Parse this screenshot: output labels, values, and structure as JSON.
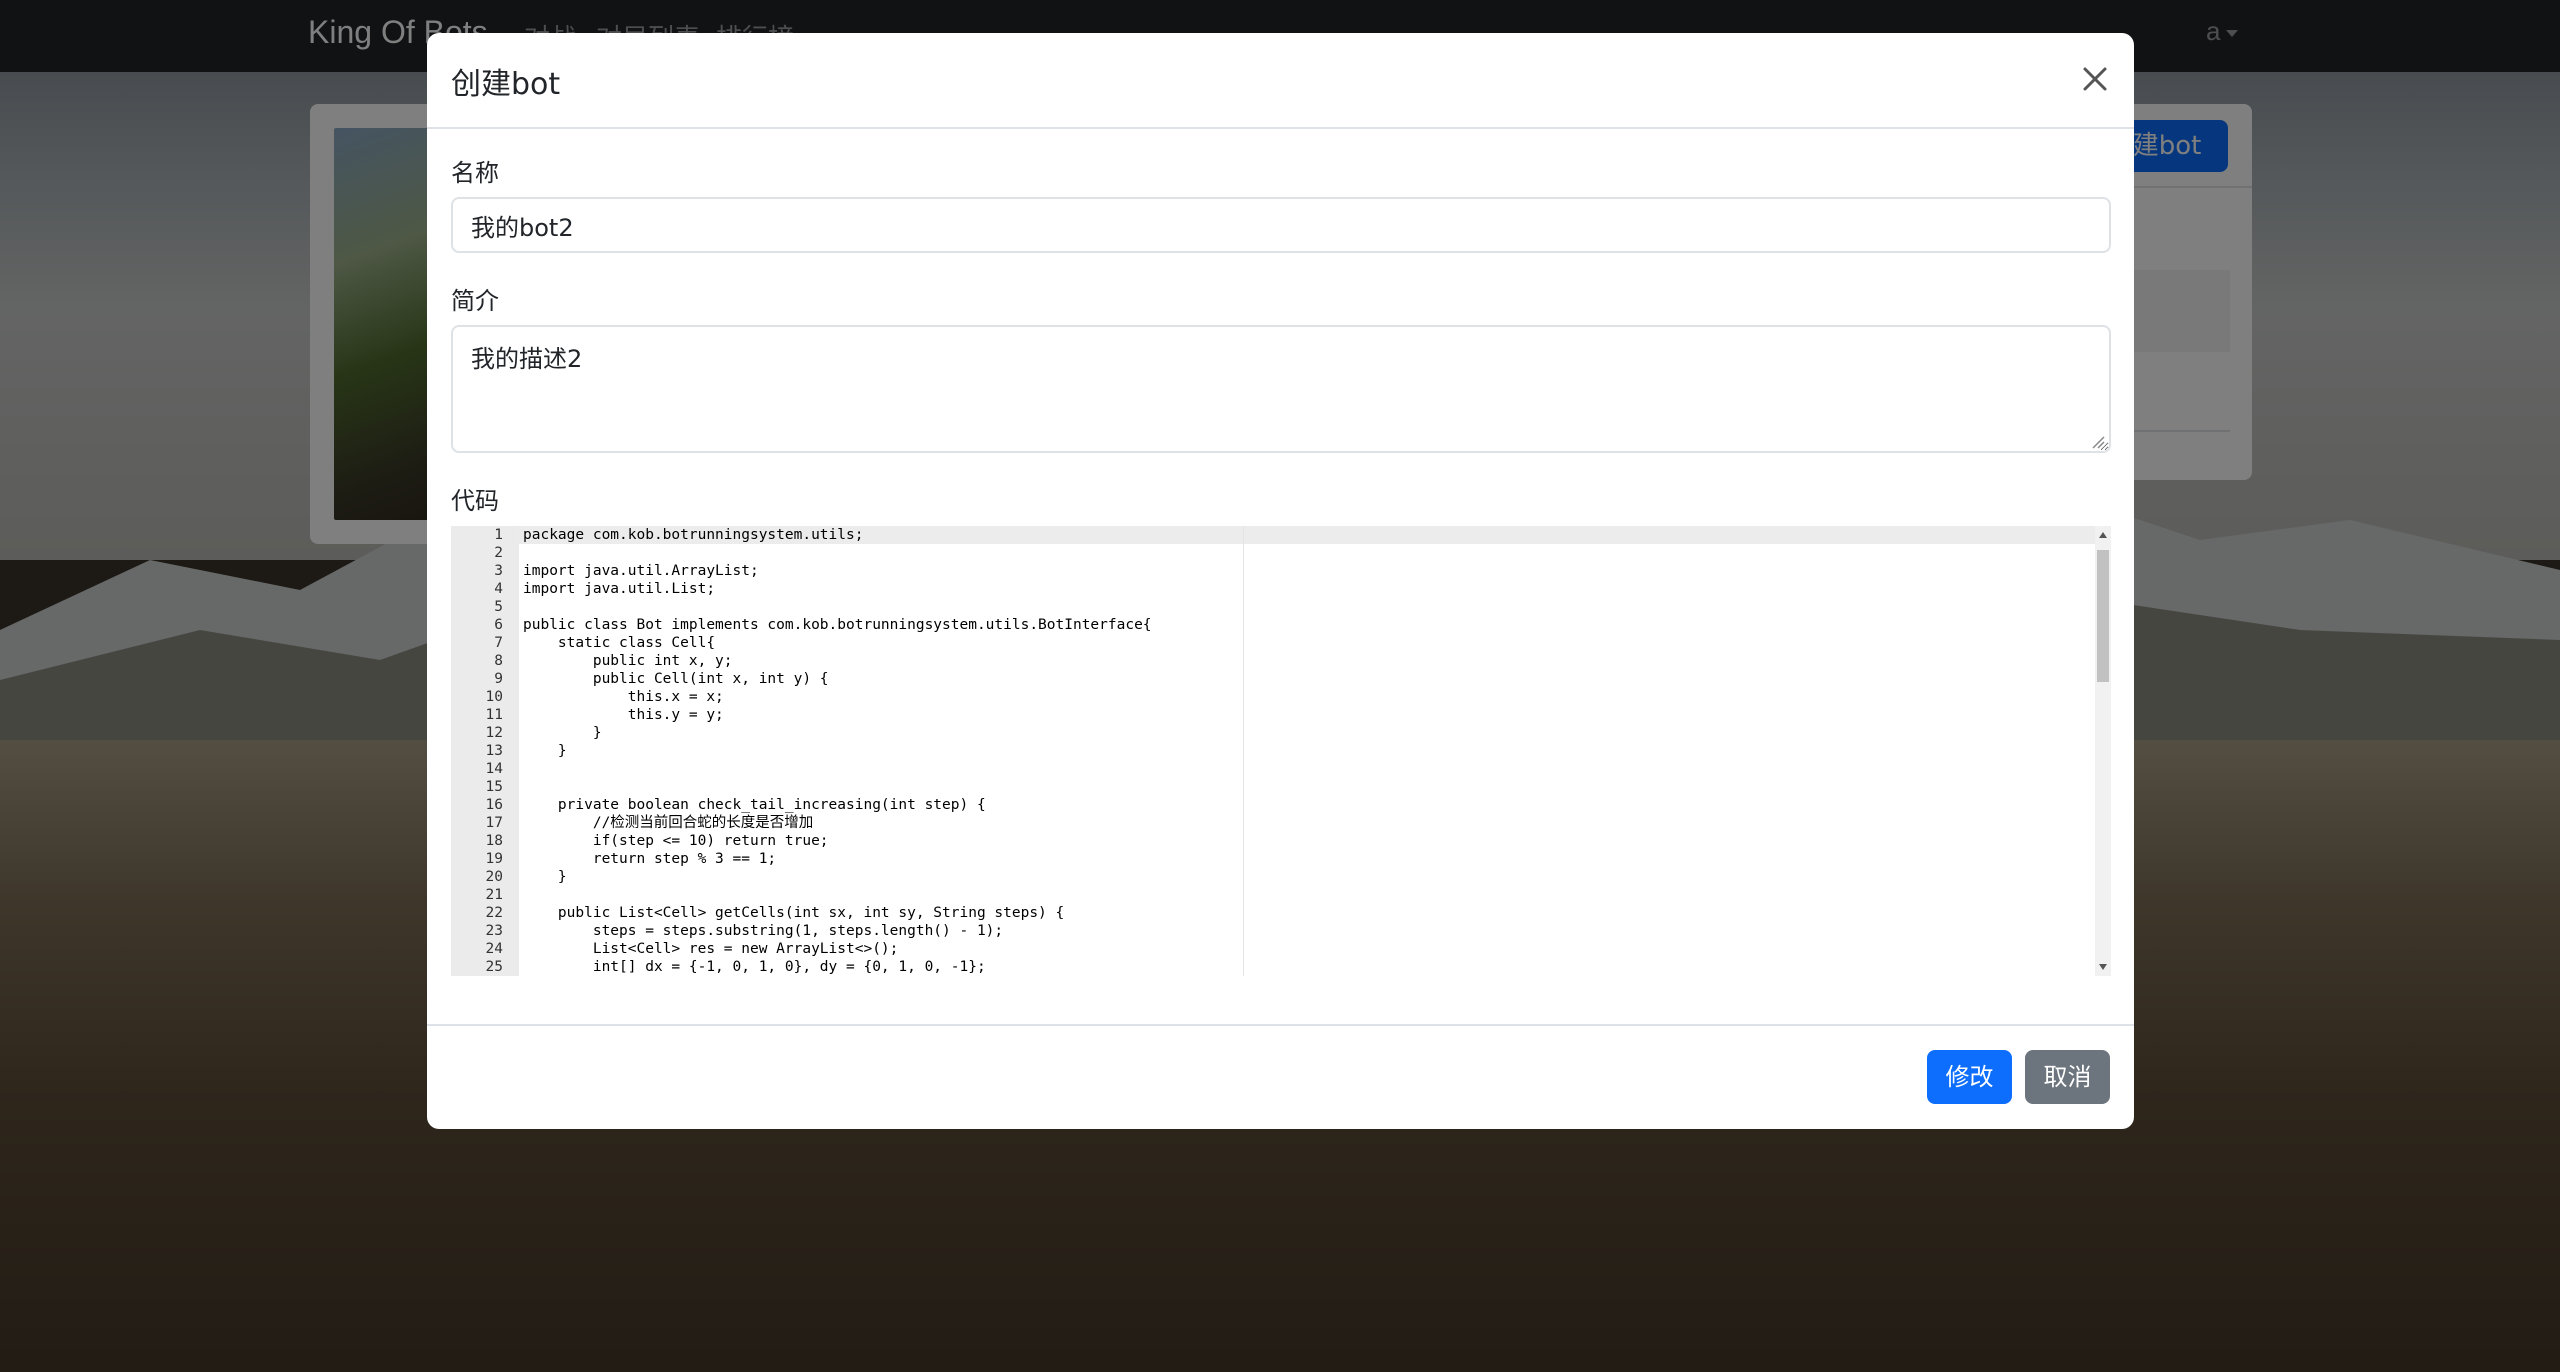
{
  "navbar": {
    "brand": "King Of Bots",
    "links": [
      "对战",
      "对局列表",
      "排行榜"
    ],
    "user": "a"
  },
  "page": {
    "create_bot_label": "创建bot"
  },
  "modal": {
    "title": "创建bot",
    "name_label": "名称",
    "name_value": "我的bot2",
    "desc_label": "简介",
    "desc_value": "我的描述2",
    "code_label": "代码",
    "code_lines": [
      "package com.kob.botrunningsystem.utils;",
      "",
      "import java.util.ArrayList;",
      "import java.util.List;",
      "",
      "public class Bot implements com.kob.botrunningsystem.utils.BotInterface{",
      "    static class Cell{",
      "        public int x, y;",
      "        public Cell(int x, int y) {",
      "            this.x = x;",
      "            this.y = y;",
      "        }",
      "    }",
      "",
      "",
      "    private boolean check_tail_increasing(int step) {",
      "        //检测当前回合蛇的长度是否增加",
      "        if(step <= 10) return true;",
      "        return step % 3 == 1;",
      "    }",
      "",
      "    public List<Cell> getCells(int sx, int sy, String steps) {",
      "        steps = steps.substring(1, steps.length() - 1);",
      "        List<Cell> res = new ArrayList<>();",
      "        int[] dx = {-1, 0, 1, 0}, dy = {0, 1, 0, -1};"
    ],
    "submit_label": "修改",
    "cancel_label": "取消"
  },
  "colors": {
    "primary": "#0d6efd",
    "secondary": "#6c757d",
    "navbar": "#212529"
  }
}
